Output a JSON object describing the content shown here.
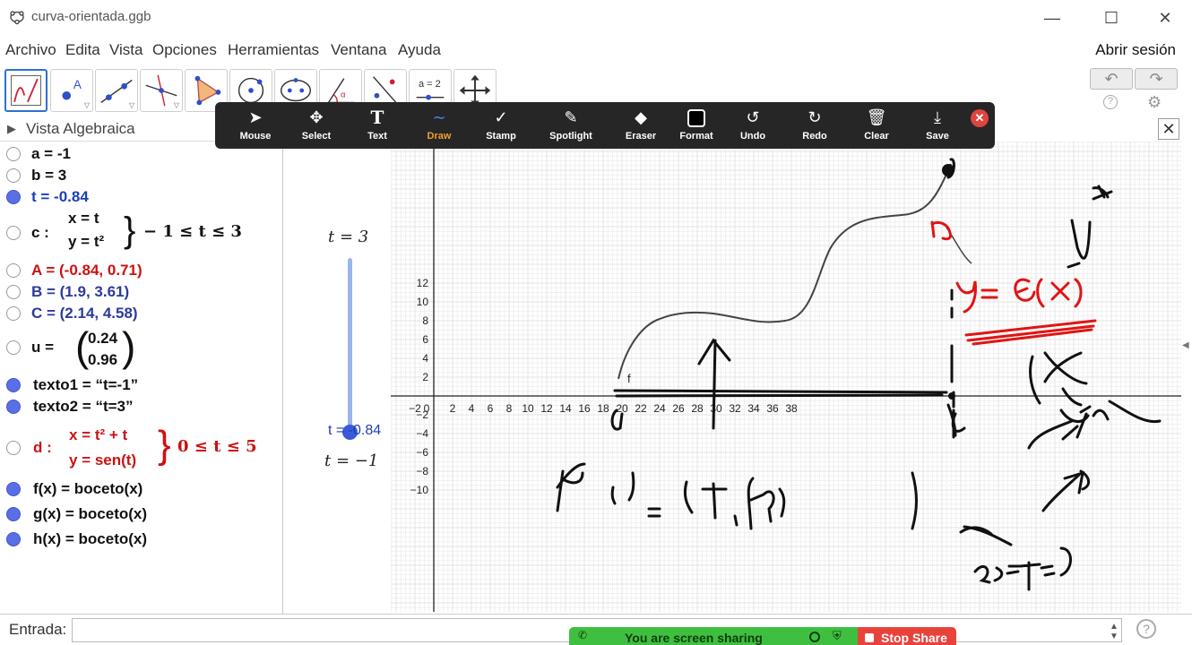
{
  "window": {
    "title": "curva-orientada.ggb"
  },
  "menu": {
    "items": [
      "Archivo",
      "Edita",
      "Vista",
      "Opciones",
      "Herramientas",
      "Ventana",
      "Ayuda"
    ],
    "login": "Abrir sesión"
  },
  "toolbar": {
    "tools": [
      "move-graphic-tool",
      "point-tool",
      "line-tool",
      "perpendicular-line-tool",
      "polygon-tool",
      "circle-tool",
      "ellipse-tool",
      "angle-tool",
      "reflect-tool",
      "slider-tool",
      "move-view-tool"
    ],
    "slider_tool_label": "a = 2"
  },
  "algebra": {
    "header": "Vista Algebraica",
    "rows": [
      {
        "text": "a = -1",
        "color": "#111111",
        "visible": false
      },
      {
        "text": "b = 3",
        "color": "#111111",
        "visible": false
      },
      {
        "text": "t = -0.84",
        "color": "#1a3fb8",
        "visible": true
      },
      {
        "name": "c :",
        "line1": "x = t",
        "line2": "y = t²",
        "range": "− 1 ≤ t ≤ 3",
        "color": "#111111",
        "visible": false
      },
      {
        "text": "A = (-0.84, 0.71)",
        "color": "#cc1111",
        "visible": false
      },
      {
        "text": "B = (1.9, 3.61)",
        "color": "#2b3a9a",
        "visible": false
      },
      {
        "text": "C = (2.14, 4.58)",
        "color": "#2b3a9a",
        "visible": false
      },
      {
        "name": "u =",
        "top": "0.24",
        "bottom": "0.96",
        "visible": false
      },
      {
        "text": "texto1  =  “t=-1”",
        "color": "#111111",
        "visible": true
      },
      {
        "text": "texto2  =  “t=3”",
        "color": "#111111",
        "visible": true
      },
      {
        "name": "d :",
        "line1": "x = t² + t",
        "line2": "y = sen(t)",
        "range": "0 ≤ t ≤ 5",
        "color": "#cc1111",
        "visible": false
      },
      {
        "text": "f(x)  =  boceto(x)",
        "color": "#111111",
        "visible": true
      },
      {
        "text": "g(x)  =  boceto(x)",
        "color": "#111111",
        "visible": true
      },
      {
        "text": "h(x)  =  boceto(x)",
        "color": "#111111",
        "visible": true
      }
    ]
  },
  "slider": {
    "top_label": "t = 3",
    "bottom_label": "t = −1",
    "value_label": "t = -0.84",
    "value": -0.84,
    "min": -1,
    "max": 3
  },
  "graphics": {
    "x_ticks": [
      -2,
      0,
      2,
      4,
      6,
      8,
      10,
      12,
      14,
      16,
      18,
      20,
      22,
      24,
      26,
      28,
      30,
      32,
      34,
      36,
      38
    ],
    "y_ticks": [
      12,
      10,
      8,
      6,
      4,
      2,
      -2,
      -4,
      -6,
      -8,
      -10
    ],
    "func_label": "f",
    "axis_color": "#222222",
    "grid_color": "#e3e3e3"
  },
  "zoom_toolbar": {
    "buttons": [
      "Mouse",
      "Select",
      "Text",
      "Draw",
      "Stamp",
      "Spotlight",
      "Eraser",
      "Format",
      "Undo",
      "Redo",
      "Clear",
      "Save"
    ],
    "active": "Draw"
  },
  "input": {
    "label": "Entrada:",
    "placeholder": ""
  },
  "share": {
    "text": "You are screen sharing",
    "stop_label": "Stop Share"
  }
}
